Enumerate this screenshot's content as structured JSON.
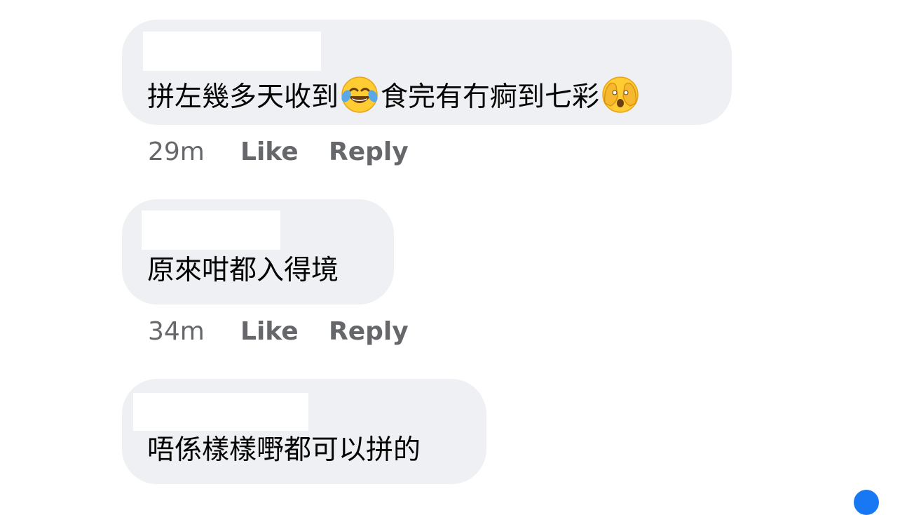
{
  "comments": [
    {
      "text_before": "拼左幾多天收到",
      "emoji_1": "face-with-tears-of-joy-emoji",
      "text_middle": "食完有冇痾到七彩",
      "emoji_2": "face-with-hand-over-mouth-emoji",
      "time": "29m",
      "like": "Like",
      "reply": "Reply"
    },
    {
      "text": "原來咁都入得境",
      "time": "34m",
      "like": "Like",
      "reply": "Reply"
    },
    {
      "text": "唔係樣樣嘢都可以拼的"
    }
  ],
  "colors": {
    "bubble": "#eff0f3",
    "text": "#050505",
    "meta": "#65676b",
    "accent": "#1877f2"
  }
}
